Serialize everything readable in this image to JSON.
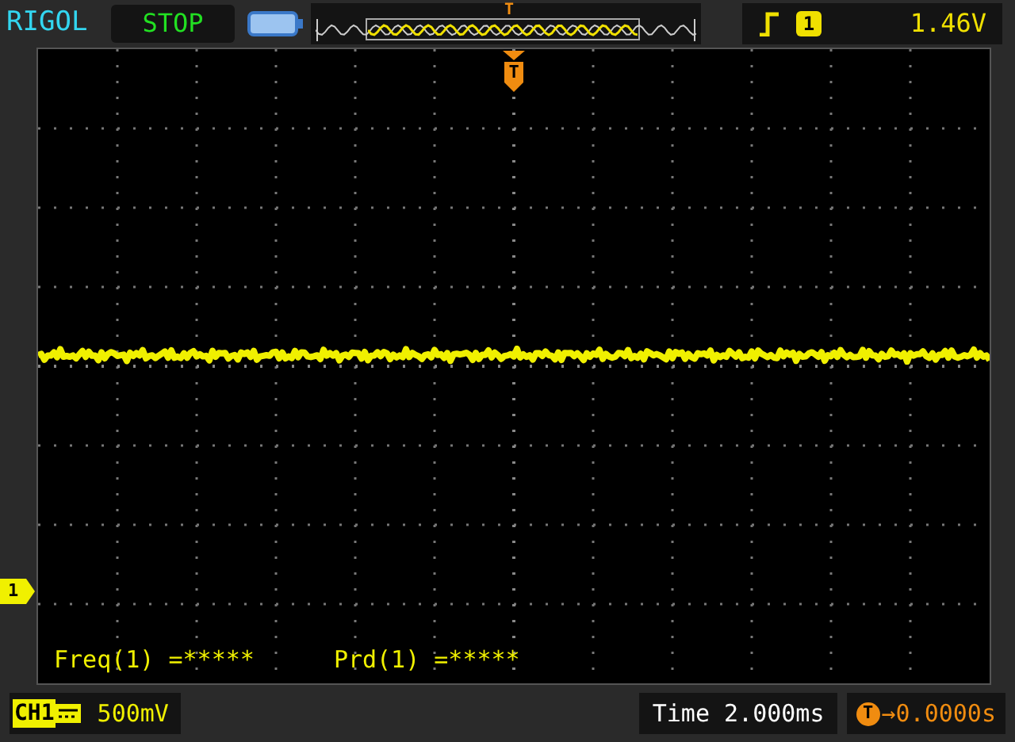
{
  "header": {
    "brand": "RIGOL",
    "run_state": {
      "kind": "stop",
      "label": "STOP"
    },
    "trigger_position_marker": "T",
    "trigger": {
      "rising_edge": true,
      "channel": "1",
      "level": "1.46V"
    }
  },
  "screen": {
    "trigger_marker": "T",
    "channel_marker": "1",
    "measurements": [
      "Freq(1) =*****",
      "Prd(1) =*****"
    ]
  },
  "footer": {
    "channel": {
      "label": "CH1",
      "dc_coupled": true,
      "scale": "500mV"
    },
    "timebase": "Time 2.000ms",
    "trigger_offset": {
      "marker": "T",
      "value": "→0.0000s"
    }
  }
}
